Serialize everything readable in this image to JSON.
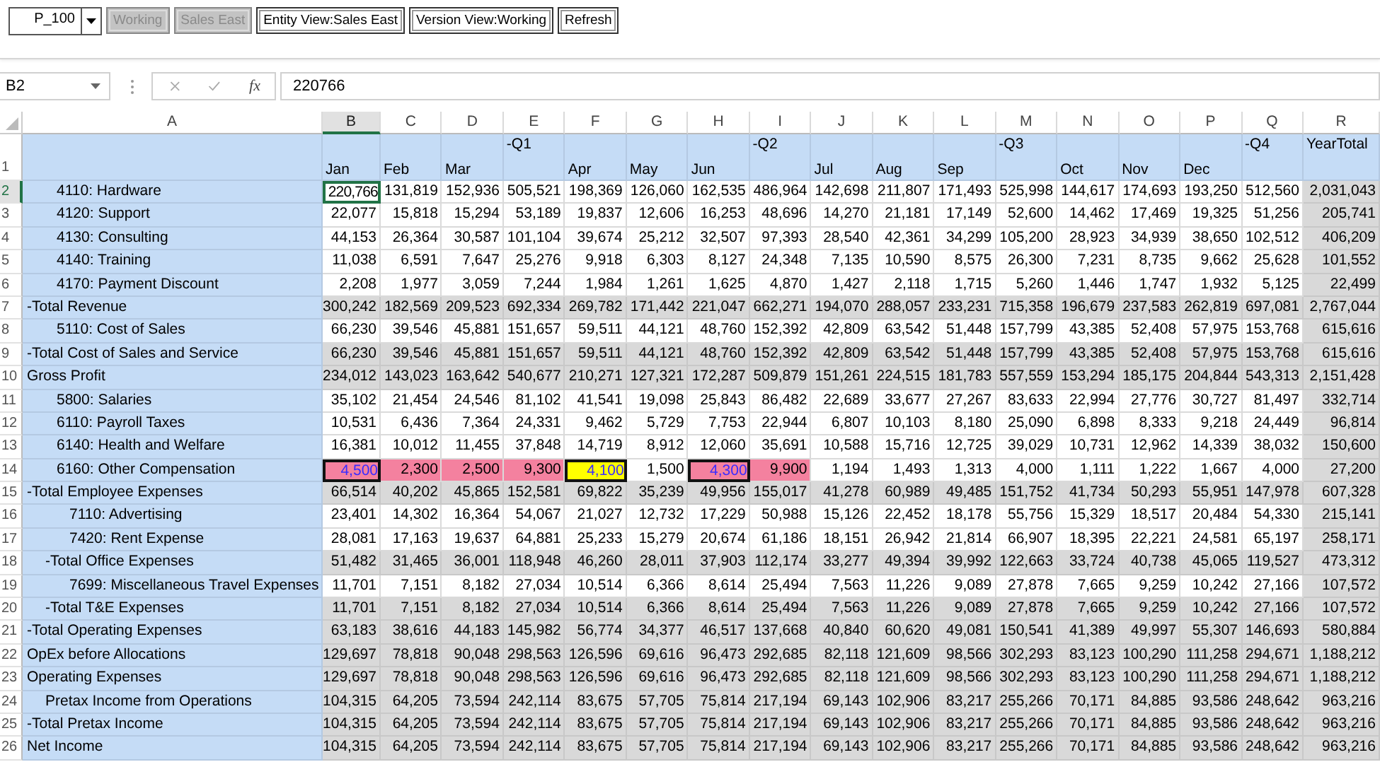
{
  "toolbar": [
    {
      "kind": "combo",
      "label": "P_100",
      "disabled": false
    },
    {
      "kind": "button",
      "label": "Working",
      "disabled": true
    },
    {
      "kind": "button",
      "label": "Sales East",
      "disabled": true
    },
    {
      "kind": "button",
      "label": "Entity View:Sales East",
      "disabled": false
    },
    {
      "kind": "button",
      "label": "Version View:Working",
      "disabled": false
    },
    {
      "kind": "button",
      "label": "Refresh",
      "disabled": false
    }
  ],
  "formula_bar": {
    "name_box": "B2",
    "function_label": "fx",
    "formula": "220766"
  },
  "sheet": {
    "column_letters": [
      {
        "letter": "A",
        "selected": false
      },
      {
        "letter": "B",
        "selected": true
      },
      {
        "letter": "C",
        "selected": false
      },
      {
        "letter": "D",
        "selected": false
      },
      {
        "letter": "E",
        "selected": false
      },
      {
        "letter": "F",
        "selected": false
      },
      {
        "letter": "G",
        "selected": false
      },
      {
        "letter": "H",
        "selected": false
      },
      {
        "letter": "I",
        "selected": false
      },
      {
        "letter": "J",
        "selected": false
      },
      {
        "letter": "K",
        "selected": false
      },
      {
        "letter": "L",
        "selected": false
      },
      {
        "letter": "M",
        "selected": false
      },
      {
        "letter": "N",
        "selected": false
      },
      {
        "letter": "O",
        "selected": false
      },
      {
        "letter": "P",
        "selected": false
      },
      {
        "letter": "Q",
        "selected": false
      },
      {
        "letter": "R",
        "selected": false
      }
    ],
    "header_row": {
      "number": "1",
      "selected": false,
      "columns": [
        {
          "label": "Jan",
          "kind": "month"
        },
        {
          "label": "Feb",
          "kind": "month"
        },
        {
          "label": "Mar",
          "kind": "month"
        },
        {
          "label": "-Q1",
          "kind": "quarter"
        },
        {
          "label": "Apr",
          "kind": "month"
        },
        {
          "label": "May",
          "kind": "month"
        },
        {
          "label": "Jun",
          "kind": "month"
        },
        {
          "label": "-Q2",
          "kind": "quarter"
        },
        {
          "label": "Jul",
          "kind": "month"
        },
        {
          "label": "Aug",
          "kind": "month"
        },
        {
          "label": "Sep",
          "kind": "month"
        },
        {
          "label": "-Q3",
          "kind": "quarter"
        },
        {
          "label": "Oct",
          "kind": "month"
        },
        {
          "label": "Nov",
          "kind": "month"
        },
        {
          "label": "Dec",
          "kind": "month"
        },
        {
          "label": "-Q4",
          "kind": "quarter"
        },
        {
          "label": "YearTotal",
          "kind": "total"
        }
      ]
    },
    "rows": [
      {
        "number": "2",
        "selected": true,
        "label": "4110: Hardware",
        "kind": "account",
        "cells": [
          "220,766",
          "131,819",
          "152,936",
          "505,521",
          "198,369",
          "126,060",
          "162,535",
          "486,964",
          "142,698",
          "211,807",
          "171,493",
          "525,998",
          "144,617",
          "174,693",
          "193,250",
          "512,560",
          "2,031,043"
        ]
      },
      {
        "number": "3",
        "selected": false,
        "label": "4120: Support",
        "kind": "account",
        "cells": [
          "22,077",
          "15,818",
          "15,294",
          "53,189",
          "19,837",
          "12,606",
          "16,253",
          "48,696",
          "14,270",
          "21,181",
          "17,149",
          "52,600",
          "14,462",
          "17,469",
          "19,325",
          "51,256",
          "205,741"
        ]
      },
      {
        "number": "4",
        "selected": false,
        "label": "4130: Consulting",
        "kind": "account",
        "cells": [
          "44,153",
          "26,364",
          "30,587",
          "101,104",
          "39,674",
          "25,212",
          "32,507",
          "97,393",
          "28,540",
          "42,361",
          "34,299",
          "105,200",
          "28,923",
          "34,939",
          "38,650",
          "102,512",
          "406,209"
        ]
      },
      {
        "number": "5",
        "selected": false,
        "label": "4140: Training",
        "kind": "account",
        "cells": [
          "11,038",
          "6,591",
          "7,647",
          "25,276",
          "9,918",
          "6,303",
          "8,127",
          "24,348",
          "7,135",
          "10,590",
          "8,575",
          "26,300",
          "7,231",
          "8,735",
          "9,662",
          "25,628",
          "101,552"
        ]
      },
      {
        "number": "6",
        "selected": false,
        "label": "4170: Payment Discount",
        "kind": "account",
        "cells": [
          "2,208",
          "1,977",
          "3,059",
          "7,244",
          "1,984",
          "1,261",
          "1,625",
          "4,870",
          "1,427",
          "2,118",
          "1,715",
          "5,260",
          "1,446",
          "1,747",
          "1,932",
          "5,125",
          "22,499"
        ]
      },
      {
        "number": "7",
        "selected": false,
        "label": "-Total Revenue",
        "kind": "total",
        "cells": [
          "300,242",
          "182,569",
          "209,523",
          "692,334",
          "269,782",
          "171,442",
          "221,047",
          "662,271",
          "194,070",
          "288,057",
          "233,231",
          "715,358",
          "196,679",
          "237,583",
          "262,819",
          "697,081",
          "2,767,044"
        ]
      },
      {
        "number": "8",
        "selected": false,
        "label": "5110: Cost of Sales",
        "kind": "account",
        "cells": [
          "66,230",
          "39,546",
          "45,881",
          "151,657",
          "59,511",
          "44,121",
          "48,760",
          "152,392",
          "42,809",
          "63,542",
          "51,448",
          "157,799",
          "43,385",
          "52,408",
          "57,975",
          "153,768",
          "615,616"
        ]
      },
      {
        "number": "9",
        "selected": false,
        "label": "-Total Cost of Sales and Service",
        "kind": "total",
        "cells": [
          "66,230",
          "39,546",
          "45,881",
          "151,657",
          "59,511",
          "44,121",
          "48,760",
          "152,392",
          "42,809",
          "63,542",
          "51,448",
          "157,799",
          "43,385",
          "52,408",
          "57,975",
          "153,768",
          "615,616"
        ]
      },
      {
        "number": "10",
        "selected": false,
        "label": "Gross Profit",
        "kind": "total",
        "cells": [
          "234,012",
          "143,023",
          "163,642",
          "540,677",
          "210,271",
          "127,321",
          "172,287",
          "509,879",
          "151,261",
          "224,515",
          "181,783",
          "557,559",
          "153,294",
          "185,175",
          "204,844",
          "543,313",
          "2,151,428"
        ]
      },
      {
        "number": "11",
        "selected": false,
        "label": "5800: Salaries",
        "kind": "account",
        "cells": [
          "35,102",
          "21,454",
          "24,546",
          "81,102",
          "41,541",
          "19,098",
          "25,843",
          "86,482",
          "22,689",
          "33,677",
          "27,267",
          "83,633",
          "22,994",
          "27,776",
          "30,727",
          "81,497",
          "332,714"
        ]
      },
      {
        "number": "12",
        "selected": false,
        "label": "6110: Payroll Taxes",
        "kind": "account",
        "cells": [
          "10,531",
          "6,436",
          "7,364",
          "24,331",
          "9,462",
          "5,729",
          "7,753",
          "22,944",
          "6,807",
          "10,103",
          "8,180",
          "25,090",
          "6,898",
          "8,333",
          "9,218",
          "24,449",
          "96,814"
        ]
      },
      {
        "number": "13",
        "selected": false,
        "label": "6140: Health and Welfare",
        "kind": "account",
        "cells": [
          "16,381",
          "10,012",
          "11,455",
          "37,848",
          "14,719",
          "8,912",
          "12,060",
          "35,691",
          "10,588",
          "15,716",
          "12,725",
          "39,029",
          "10,731",
          "12,962",
          "14,339",
          "38,032",
          "150,600"
        ]
      },
      {
        "number": "14",
        "selected": false,
        "label": "6160: Other Compensation",
        "kind": "account",
        "cells": [
          {
            "value": "4,500",
            "color": "#f4819f",
            "edited": true
          },
          {
            "value": "2,300",
            "color": "#f4819f",
            "edited": false
          },
          {
            "value": "2,500",
            "color": "#f4819f",
            "edited": false
          },
          {
            "value": "9,300",
            "color": "#f4819f",
            "edited": false
          },
          {
            "value": "4,100",
            "color": "#ffff00",
            "edited": true
          },
          "1,500",
          {
            "value": "4,300",
            "color": "#f4819f",
            "edited": true
          },
          {
            "value": "9,900",
            "color": "#f4819f",
            "edited": false
          },
          "1,194",
          "1,493",
          "1,313",
          "4,000",
          "1,111",
          "1,222",
          "1,667",
          "4,000",
          "27,200"
        ]
      },
      {
        "number": "15",
        "selected": false,
        "label": "-Total Employee Expenses",
        "kind": "total",
        "cells": [
          "66,514",
          "40,202",
          "45,865",
          "152,581",
          "69,822",
          "35,239",
          "49,956",
          "155,017",
          "41,278",
          "60,989",
          "49,485",
          "151,752",
          "41,734",
          "50,293",
          "55,951",
          "147,978",
          "607,328"
        ]
      },
      {
        "number": "16",
        "selected": false,
        "label": "7110: Advertising",
        "kind": "sub-account",
        "cells": [
          "23,401",
          "14,302",
          "16,364",
          "54,067",
          "21,027",
          "12,732",
          "17,229",
          "50,988",
          "15,126",
          "22,452",
          "18,178",
          "55,756",
          "15,329",
          "18,517",
          "20,484",
          "54,330",
          "215,141"
        ]
      },
      {
        "number": "17",
        "selected": false,
        "label": "7420: Rent Expense",
        "kind": "sub-account",
        "cells": [
          "28,081",
          "17,163",
          "19,637",
          "64,881",
          "25,233",
          "15,279",
          "20,674",
          "61,186",
          "18,151",
          "26,942",
          "21,814",
          "66,907",
          "18,395",
          "22,221",
          "24,581",
          "65,197",
          "258,171"
        ]
      },
      {
        "number": "18",
        "selected": false,
        "label": "-Total Office Expenses",
        "kind": "subtotal",
        "cells": [
          "51,482",
          "31,465",
          "36,001",
          "118,948",
          "46,260",
          "28,011",
          "37,903",
          "112,174",
          "33,277",
          "49,394",
          "39,992",
          "122,663",
          "33,724",
          "40,738",
          "45,065",
          "119,527",
          "473,312"
        ]
      },
      {
        "number": "19",
        "selected": false,
        "label": "7699: Miscellaneous Travel Expenses",
        "kind": "sub-account",
        "cells": [
          "11,701",
          "7,151",
          "8,182",
          "27,034",
          "10,514",
          "6,366",
          "8,614",
          "25,494",
          "7,563",
          "11,226",
          "9,089",
          "27,878",
          "7,665",
          "9,259",
          "10,242",
          "27,166",
          "107,572"
        ]
      },
      {
        "number": "20",
        "selected": false,
        "label": "-Total T&E Expenses",
        "kind": "subtotal",
        "cells": [
          "11,701",
          "7,151",
          "8,182",
          "27,034",
          "10,514",
          "6,366",
          "8,614",
          "25,494",
          "7,563",
          "11,226",
          "9,089",
          "27,878",
          "7,665",
          "9,259",
          "10,242",
          "27,166",
          "107,572"
        ]
      },
      {
        "number": "21",
        "selected": false,
        "label": "-Total Operating Expenses",
        "kind": "total",
        "cells": [
          "63,183",
          "38,616",
          "44,183",
          "145,982",
          "56,774",
          "34,377",
          "46,517",
          "137,668",
          "40,840",
          "60,620",
          "49,081",
          "150,541",
          "41,389",
          "49,997",
          "55,307",
          "146,693",
          "580,884"
        ]
      },
      {
        "number": "22",
        "selected": false,
        "label": "OpEx before Allocations",
        "kind": "total",
        "cells": [
          "129,697",
          "78,818",
          "90,048",
          "298,563",
          "126,596",
          "69,616",
          "96,473",
          "292,685",
          "82,118",
          "121,609",
          "98,566",
          "302,293",
          "83,123",
          "100,290",
          "111,258",
          "294,671",
          "1,188,212"
        ]
      },
      {
        "number": "23",
        "selected": false,
        "label": "Operating Expenses",
        "kind": "total",
        "cells": [
          "129,697",
          "78,818",
          "90,048",
          "298,563",
          "126,596",
          "69,616",
          "96,473",
          "292,685",
          "82,118",
          "121,609",
          "98,566",
          "302,293",
          "83,123",
          "100,290",
          "111,258",
          "294,671",
          "1,188,212"
        ]
      },
      {
        "number": "24",
        "selected": false,
        "label": "Pretax Income from Operations",
        "kind": "subtotal",
        "cells": [
          "104,315",
          "64,205",
          "73,594",
          "242,114",
          "83,675",
          "57,705",
          "75,814",
          "217,194",
          "69,143",
          "102,906",
          "83,217",
          "255,266",
          "70,171",
          "84,885",
          "93,586",
          "248,642",
          "963,216"
        ]
      },
      {
        "number": "25",
        "selected": false,
        "label": "-Total Pretax Income",
        "kind": "total",
        "cells": [
          "104,315",
          "64,205",
          "73,594",
          "242,114",
          "83,675",
          "57,705",
          "75,814",
          "217,194",
          "69,143",
          "102,906",
          "83,217",
          "255,266",
          "70,171",
          "84,885",
          "93,586",
          "248,642",
          "963,216"
        ]
      },
      {
        "number": "26",
        "selected": false,
        "label": "Net Income",
        "kind": "total",
        "cells": [
          "104,315",
          "64,205",
          "73,594",
          "242,114",
          "83,675",
          "57,705",
          "75,814",
          "217,194",
          "69,143",
          "102,906",
          "83,217",
          "255,266",
          "70,171",
          "84,885",
          "93,586",
          "248,642",
          "963,216"
        ]
      }
    ]
  }
}
